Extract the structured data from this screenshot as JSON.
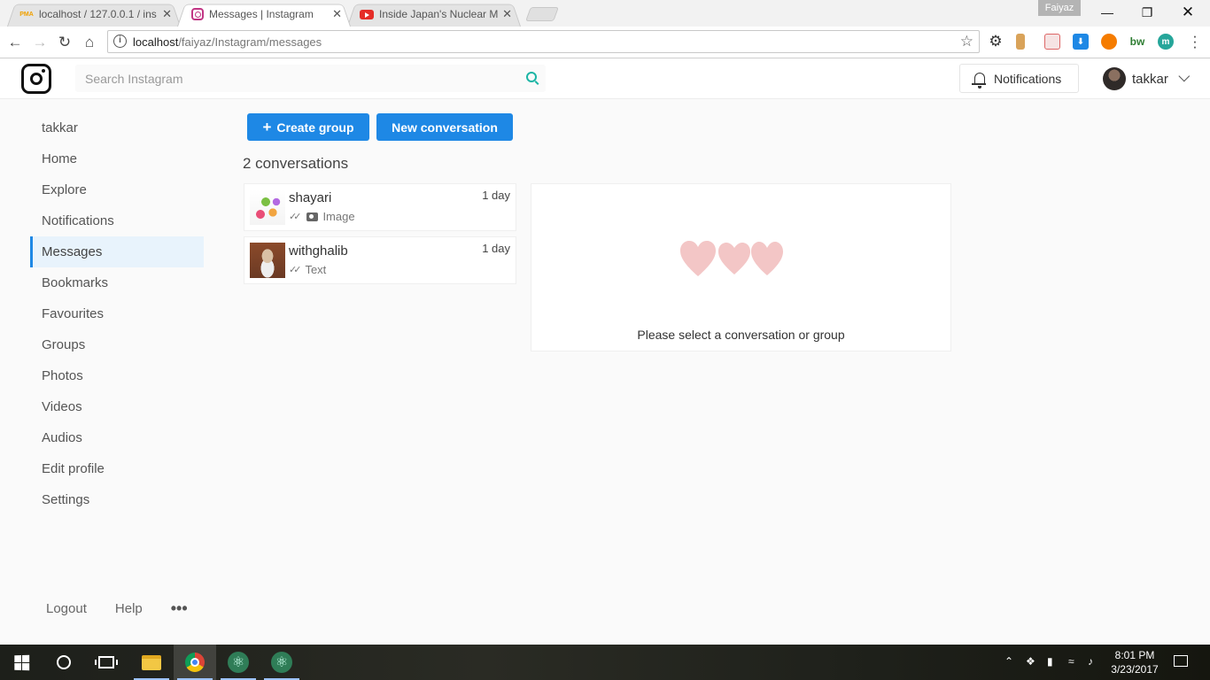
{
  "browser": {
    "tabs": [
      {
        "title": "localhost / 127.0.0.1 / ins",
        "favicon": "phpmyadmin-icon",
        "active": false
      },
      {
        "title": "Messages | Instagram",
        "favicon": "instagram-icon",
        "active": true
      },
      {
        "title": "Inside Japan's Nuclear M",
        "favicon": "youtube-icon",
        "active": false
      }
    ],
    "profile_name": "Faiyaz",
    "url_host": "localhost",
    "url_path": "/faiyaz/Instagram/messages",
    "extensions": [
      "settings-gear-icon",
      "bookmark-icon",
      "tab-icon",
      "download-icon",
      "avast-icon",
      "bw-icon",
      "m-icon"
    ]
  },
  "header": {
    "search_placeholder": "Search Instagram",
    "notifications_label": "Notifications",
    "username": "takkar"
  },
  "sidebar": {
    "items": [
      {
        "label": "takkar"
      },
      {
        "label": "Home"
      },
      {
        "label": "Explore"
      },
      {
        "label": "Notifications"
      },
      {
        "label": "Messages"
      },
      {
        "label": "Bookmarks"
      },
      {
        "label": "Favourites"
      },
      {
        "label": "Groups"
      },
      {
        "label": "Photos"
      },
      {
        "label": "Videos"
      },
      {
        "label": "Audios"
      },
      {
        "label": "Edit profile"
      },
      {
        "label": "Settings"
      }
    ],
    "active_item": "Messages",
    "footer": {
      "logout": "Logout",
      "help": "Help",
      "more": "•••"
    }
  },
  "main": {
    "create_group_label": "Create group",
    "new_conversation_label": "New conversation",
    "conversation_count": "2 conversations",
    "conversations": [
      {
        "name": "shayari",
        "preview": "Image",
        "time": "1 day",
        "has_camera": true
      },
      {
        "name": "withghalib",
        "preview": "Text",
        "time": "1 day",
        "has_camera": false
      }
    ],
    "empty_message": "Please select a conversation or group"
  },
  "taskbar": {
    "time": "8:01 PM",
    "date": "3/23/2017"
  },
  "colors": {
    "accent": "#1e88e5",
    "active_bg": "#e8f3fc",
    "heart": "#f3c6c6",
    "search_icon": "#1cb5a5"
  }
}
